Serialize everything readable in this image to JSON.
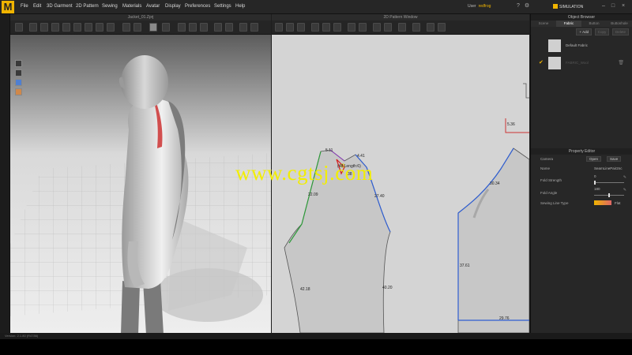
{
  "app": {
    "logo_letter": "M",
    "menu": [
      "File",
      "Edit",
      "3D Garment",
      "2D Pattern",
      "Sewing",
      "Materials",
      "Avatar",
      "Display",
      "Preferences",
      "Settings",
      "Help"
    ],
    "user_prefix": "User",
    "user_name": "redfrog",
    "mode": "SIMULATION",
    "accent_color": "#f0b400"
  },
  "viewport3d": {
    "title": "Jacket_01.Zprj",
    "status": "Version: 2.1.80 (R4786)"
  },
  "viewport2d": {
    "title": "2D Pattern Window",
    "measurements": [
      "5.11",
      "4.41",
      "(48 Length:6)",
      "38",
      "22.09",
      "27.40",
      "42.18",
      "40.20",
      "5.36",
      "30.34",
      "37.61",
      "29.76"
    ]
  },
  "object_browser": {
    "title": "Object Browser",
    "tabs": [
      "Scene",
      "Fabric",
      "Button",
      "Buttonhole"
    ],
    "active_tab": "Fabric",
    "actions": [
      "+ Add",
      "Copy",
      "Delete"
    ],
    "fabrics": [
      {
        "name": "Default Fabric",
        "checked": false
      },
      {
        "name": "FABRIC_Wool",
        "checked": true
      }
    ]
  },
  "property_editor": {
    "title": "Property Editor",
    "camera_label": "Camera",
    "open_label": "Open",
    "save_label": "Save",
    "name_label": "Name",
    "name_value": "SeamLinePair2nc",
    "fold_strength_label": "Fold Strength",
    "fold_strength_value": "0",
    "fold_angle_label": "Fold Angle",
    "fold_angle_value": "180",
    "sewing_line_type_label": "Sewing Line Type",
    "sewing_line_type_value": "Flat",
    "fold_strength_fraction": 0.0,
    "fold_angle_fraction": 0.5
  },
  "watermark": "www.cgtsj.com"
}
